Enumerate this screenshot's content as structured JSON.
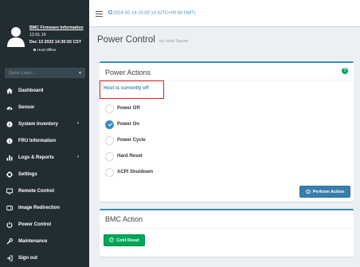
{
  "sidebar": {
    "firmware_link": "BMC Firmware Information",
    "firmware_version": "12.01.19",
    "firmware_date": "Dec 13 2023 14:30:55 CST",
    "host_status": "Host Offline",
    "quick_links_placeholder": "Quick Links...",
    "menu": [
      {
        "label": "Dashboard",
        "icon": "dashboard-icon",
        "has_arrow": false
      },
      {
        "label": "Sensor",
        "icon": "sensor-icon",
        "has_arrow": false
      },
      {
        "label": "System Inventory",
        "icon": "info-icon",
        "has_arrow": true
      },
      {
        "label": "FRU Information",
        "icon": "info-icon",
        "has_arrow": false
      },
      {
        "label": "Logs & Reports",
        "icon": "chart-icon",
        "has_arrow": true
      },
      {
        "label": "Settings",
        "icon": "gear-icon",
        "has_arrow": false
      },
      {
        "label": "Remote Control",
        "icon": "monitor-icon",
        "has_arrow": false
      },
      {
        "label": "Image Redirection",
        "icon": "disk-icon",
        "has_arrow": false
      },
      {
        "label": "Power Control",
        "icon": "power-icon",
        "has_arrow": false
      },
      {
        "label": "Maintenance",
        "icon": "wrench-icon",
        "has_arrow": false
      },
      {
        "label": "Sign out",
        "icon": "signout-icon",
        "has_arrow": false
      }
    ]
  },
  "topbar": {
    "datetime": "2024-02-14 15:02:14 (UTC+00:00 GMT)"
  },
  "page": {
    "title": "Power Control",
    "subtitle": "on Host Server"
  },
  "power_actions": {
    "title": "Power Actions",
    "host_status": "Host is currently off",
    "options": [
      {
        "label": "Power Off",
        "checked": false
      },
      {
        "label": "Power On",
        "checked": true
      },
      {
        "label": "Power Cycle",
        "checked": false
      },
      {
        "label": "Hard Reset",
        "checked": false
      },
      {
        "label": "ACPI Shutdown",
        "checked": false
      }
    ],
    "perform_button": "Perform Action"
  },
  "bmc_action": {
    "title": "BMC Action",
    "cold_reset_button": "Cold Reset"
  },
  "colors": {
    "sidebar_bg": "#222d32",
    "accent": "#3c8dbc",
    "success": "#00a65a",
    "highlight_border": "#dd1c1c"
  }
}
